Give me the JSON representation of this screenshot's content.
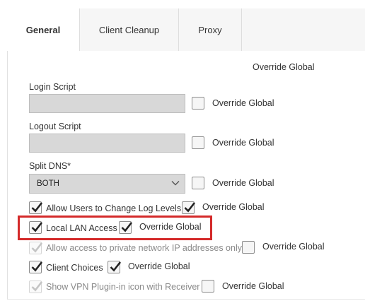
{
  "tabs": [
    {
      "label": "General",
      "active": true
    },
    {
      "label": "Client Cleanup",
      "active": false
    },
    {
      "label": "Proxy",
      "active": false
    }
  ],
  "column_header": "Override Global",
  "login_script": {
    "label": "Login Script",
    "value": "",
    "override_label": "Override Global",
    "override_checked": false
  },
  "logout_script": {
    "label": "Logout Script",
    "value": "",
    "override_label": "Override Global",
    "override_checked": false
  },
  "split_dns": {
    "label": "Split DNS*",
    "selected": "BOTH",
    "override_label": "Override Global",
    "override_checked": false
  },
  "options": [
    {
      "label": "Allow Users to Change Log Levels",
      "checked": true,
      "disabled": false,
      "override_label": "Override Global",
      "override_checked": true
    },
    {
      "label": "Local LAN Access",
      "checked": true,
      "disabled": false,
      "override_label": "Override Global",
      "override_checked": true
    },
    {
      "label": "Allow access to private network IP addresses only",
      "checked": true,
      "disabled": true,
      "override_label": "Override Global",
      "override_checked": false
    },
    {
      "label": "Client Choices",
      "checked": true,
      "disabled": false,
      "override_label": "Override Global",
      "override_checked": true
    },
    {
      "label": "Show VPN Plugin-in icon with Receiver",
      "checked": true,
      "disabled": true,
      "override_label": "Override Global",
      "override_checked": false
    }
  ],
  "colors": {
    "highlight": "#d42a2a",
    "field_bg": "#d8d8d8",
    "tab_bg": "#f6f6f6"
  }
}
